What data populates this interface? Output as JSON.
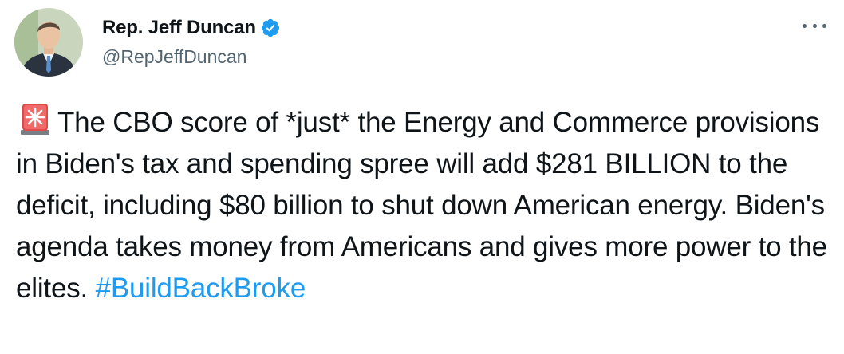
{
  "author": {
    "display_name": "Rep. Jeff Duncan",
    "handle": "@RepJeffDuncan",
    "verified": true
  },
  "tweet": {
    "leading_emoji": "police-car-light-icon",
    "text": "The CBO score of *just* the Energy and Commerce provisions in Biden's tax and spending spree will add $281 BILLION to the deficit, including $80 billion to shut down American energy. Biden's agenda takes money from Americans and gives more power to the elites.",
    "hashtag": "#BuildBackBroke"
  },
  "colors": {
    "text": "#0f1419",
    "secondary": "#536471",
    "link": "#1d9bf0",
    "verified": "#1d9bf0"
  }
}
